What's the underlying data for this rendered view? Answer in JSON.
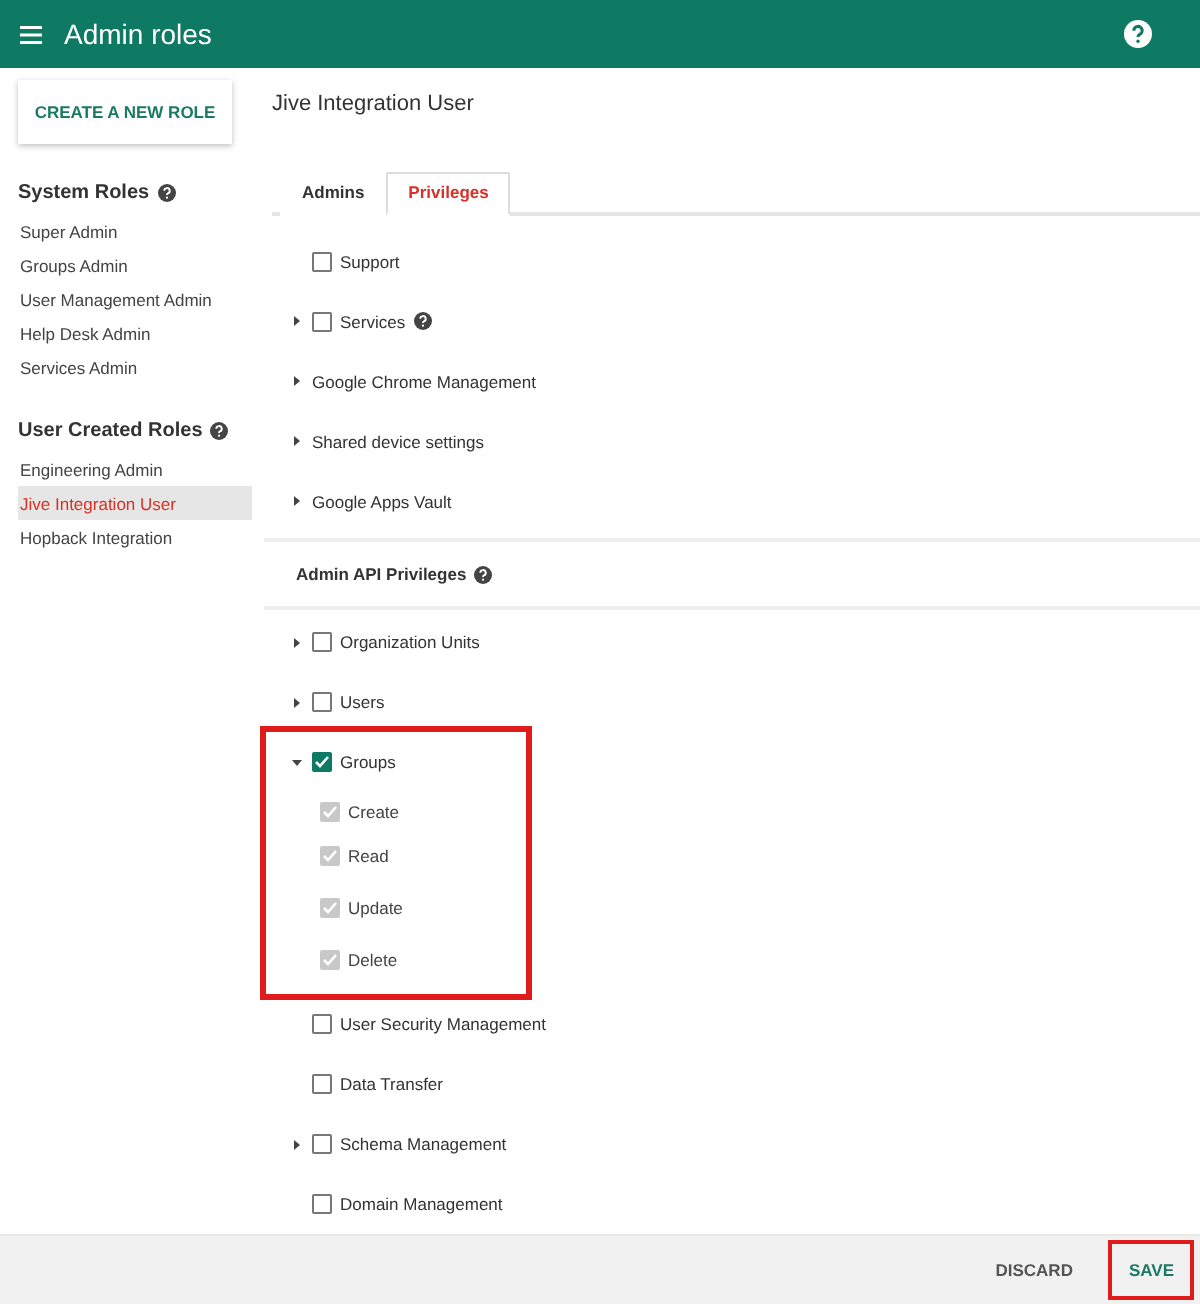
{
  "app_bar": {
    "title": "Admin roles"
  },
  "sidebar": {
    "create_button": "CREATE A NEW ROLE",
    "sections": [
      {
        "title": "System Roles",
        "items": [
          {
            "label": "Super Admin",
            "selected": false
          },
          {
            "label": "Groups Admin",
            "selected": false
          },
          {
            "label": "User Management Admin",
            "selected": false
          },
          {
            "label": "Help Desk Admin",
            "selected": false
          },
          {
            "label": "Services Admin",
            "selected": false
          }
        ]
      },
      {
        "title": "User Created Roles",
        "items": [
          {
            "label": "Engineering Admin",
            "selected": false
          },
          {
            "label": "Jive Integration User",
            "selected": true
          },
          {
            "label": "Hopback Integration",
            "selected": false
          }
        ]
      }
    ]
  },
  "role_title": "Jive Integration User",
  "tabs": [
    {
      "label": "Admins",
      "selected": false
    },
    {
      "label": "Privileges",
      "selected": true
    }
  ],
  "privileges": [
    {
      "kind": "checkbox",
      "label": "Support",
      "checked": false
    },
    {
      "kind": "checkbox",
      "label": "Services",
      "checked": false,
      "expanded": false,
      "help": true
    },
    {
      "kind": "plain",
      "label": "Google Chrome Management",
      "expanded": false
    },
    {
      "kind": "plain",
      "label": "Shared device settings",
      "expanded": false
    },
    {
      "kind": "plain",
      "label": "Google Apps Vault",
      "expanded": false
    }
  ],
  "api_section": {
    "title": "Admin API Privileges"
  },
  "api_privileges": [
    {
      "kind": "checkbox",
      "label": "Organization Units",
      "checked": false,
      "expanded": false
    },
    {
      "kind": "checkbox",
      "label": "Users",
      "checked": false,
      "expanded": false
    },
    {
      "kind": "checkbox",
      "label": "Groups",
      "checked": true,
      "expanded": true,
      "highlighted": true,
      "children": [
        {
          "label": "Create",
          "checked": true,
          "disabled": true
        },
        {
          "label": "Read",
          "checked": true,
          "disabled": true
        },
        {
          "label": "Update",
          "checked": true,
          "disabled": true
        },
        {
          "label": "Delete",
          "checked": true,
          "disabled": true
        }
      ]
    },
    {
      "kind": "checkbox",
      "label": "User Security Management",
      "checked": false
    },
    {
      "kind": "checkbox",
      "label": "Data Transfer",
      "checked": false
    },
    {
      "kind": "checkbox",
      "label": "Schema Management",
      "checked": false,
      "expanded": false
    },
    {
      "kind": "checkbox",
      "label": "Domain Management",
      "checked": false
    }
  ],
  "footer": {
    "buttons": [
      {
        "label": "DISCARD",
        "kind": "secondary",
        "highlighted": false
      },
      {
        "label": "SAVE",
        "kind": "primary",
        "highlighted": true
      }
    ]
  }
}
